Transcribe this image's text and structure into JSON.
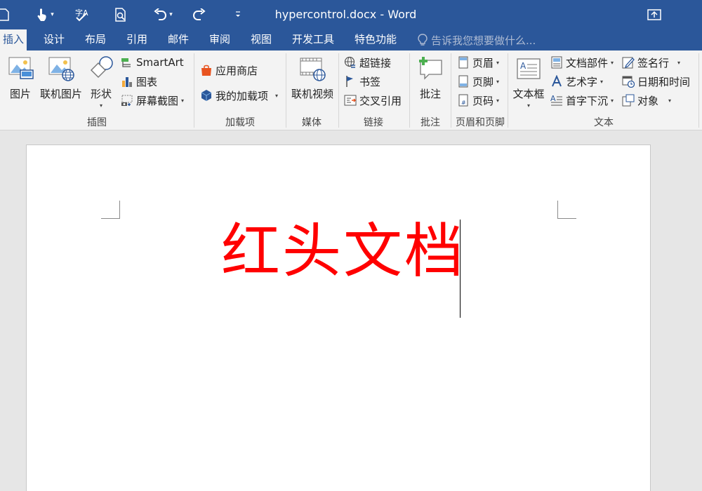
{
  "window": {
    "title": "hypercontrol.docx - Word"
  },
  "tabs": [
    {
      "label": "插入",
      "active": true
    },
    {
      "label": "设计"
    },
    {
      "label": "布局"
    },
    {
      "label": "引用"
    },
    {
      "label": "邮件"
    },
    {
      "label": "审阅"
    },
    {
      "label": "视图"
    },
    {
      "label": "开发工具"
    },
    {
      "label": "特色功能"
    }
  ],
  "tell_me": {
    "placeholder": "告诉我您想要做什么..."
  },
  "ribbon": {
    "illustrations": {
      "label": "插图",
      "picture": "图片",
      "online_picture": "联机图片",
      "shapes": "形状",
      "smartart": "SmartArt",
      "chart": "图表",
      "screenshot": "屏幕截图"
    },
    "addins": {
      "label": "加载项",
      "store": "应用商店",
      "my_addins": "我的加载项"
    },
    "media": {
      "label": "媒体",
      "online_video": "联机视频"
    },
    "links": {
      "label": "链接",
      "hyperlink": "超链接",
      "bookmark": "书签",
      "cross_reference": "交叉引用"
    },
    "comments": {
      "label": "批注",
      "comment": "批注"
    },
    "header_footer": {
      "label": "页眉和页脚",
      "header": "页眉",
      "footer": "页脚",
      "page_number": "页码"
    },
    "text": {
      "label": "文本",
      "textbox": "文本框",
      "quick_parts": "文档部件",
      "wordart": "艺术字",
      "drop_cap": "首字下沉",
      "signature_line": "签名行",
      "date_time": "日期和时间",
      "object": "对象"
    }
  },
  "document": {
    "heading": "红头文档",
    "heading_color": "#ff0000"
  },
  "colors": {
    "accent": "#2b579a",
    "ribbon_bg": "#f3f3f3",
    "canvas_bg": "#e6e6e6"
  }
}
